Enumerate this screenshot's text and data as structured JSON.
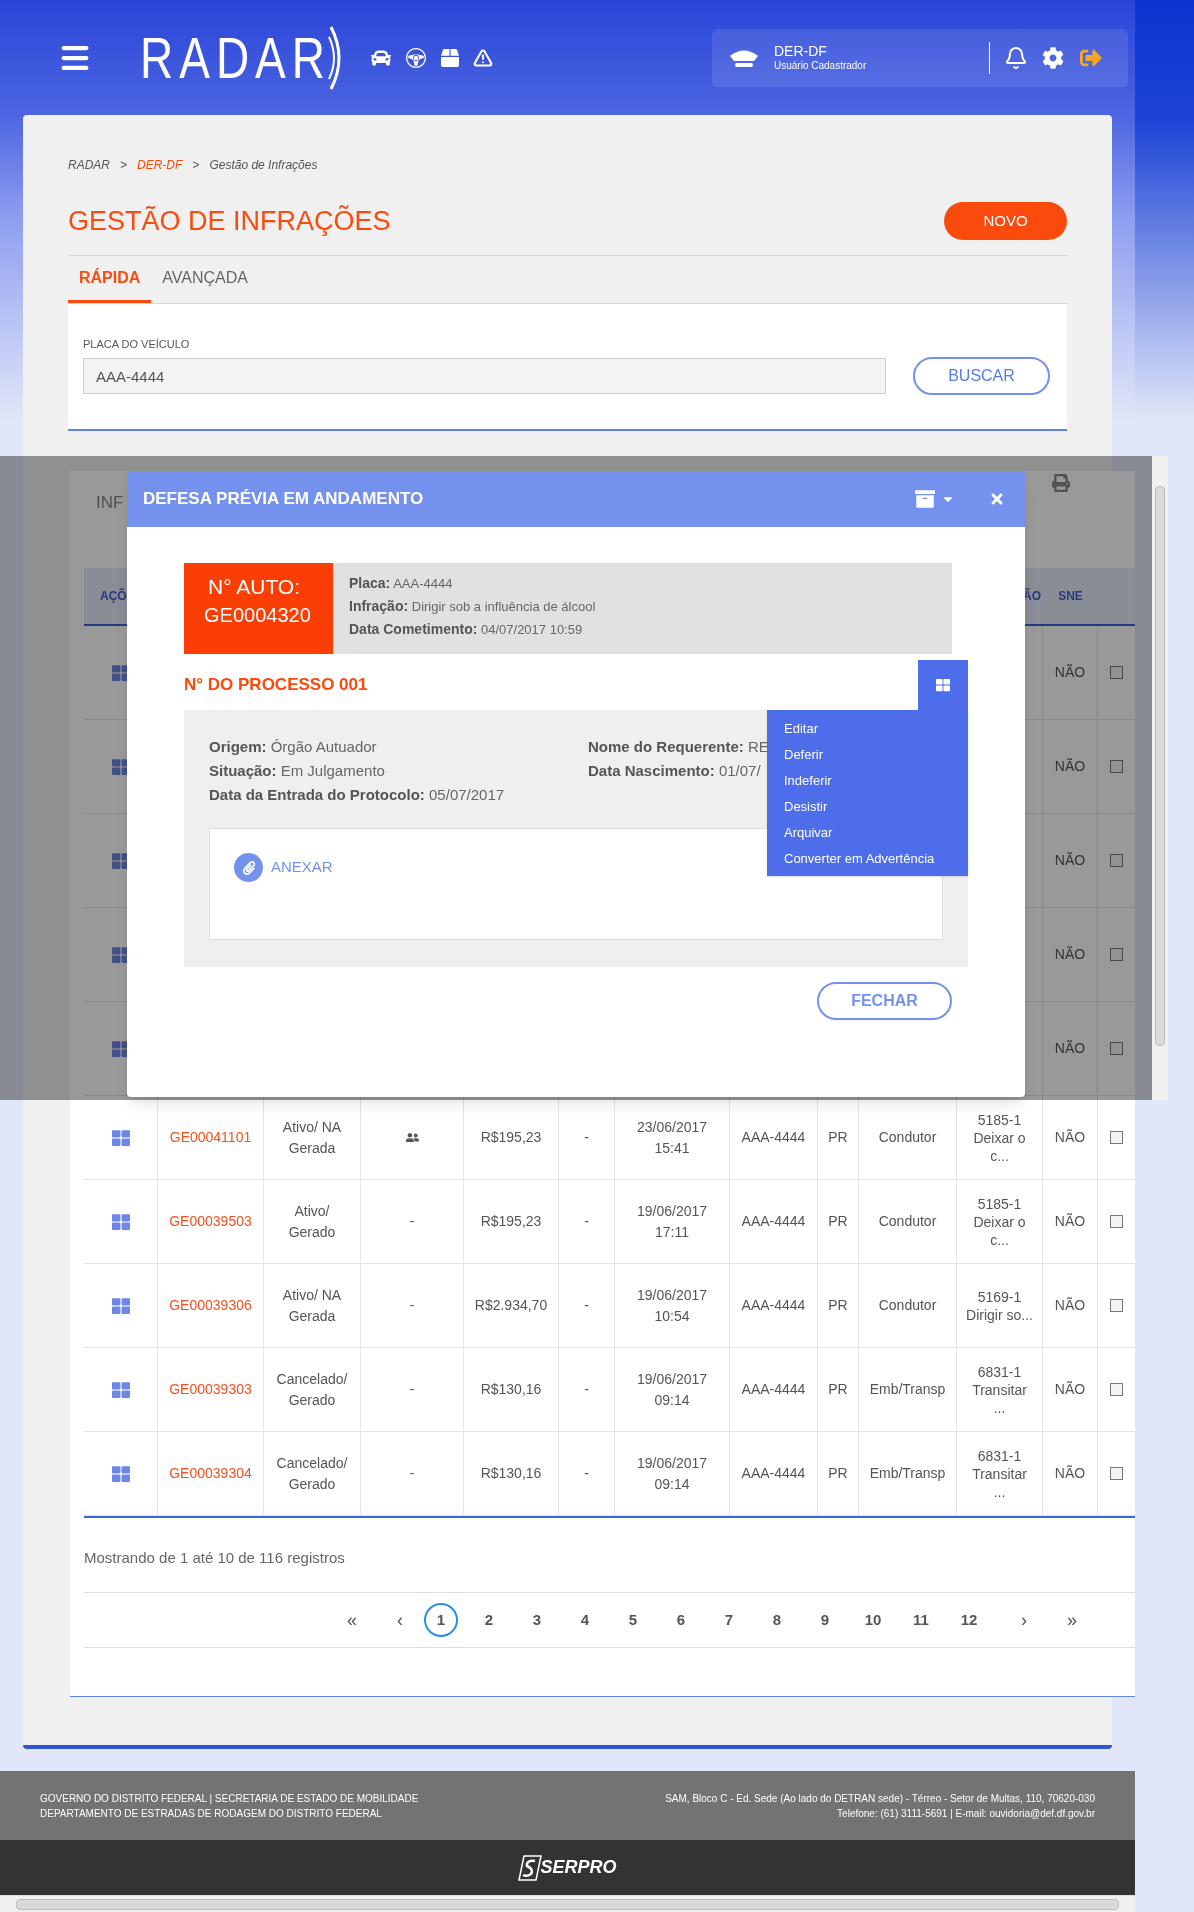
{
  "header": {
    "logo": "RADAR",
    "org": "DER-DF",
    "role": "Usuário Cadastrador"
  },
  "breadcrumb": [
    {
      "label": "RADAR",
      "link": false
    },
    {
      "sep": ">",
      "label": "DER-DF",
      "link": true
    },
    {
      "sep": ">",
      "label": "Gestão de Infrações",
      "link": false
    }
  ],
  "page_title": "GESTÃO DE INFRAÇÕES",
  "new_button": "NOVO",
  "tabs": [
    {
      "label": "RÁPIDA",
      "selected": true
    },
    {
      "label": "AVANÇADA",
      "selected": false
    }
  ],
  "search": {
    "label": "PLACA DO VEÍCULO",
    "value": "AAA-4444",
    "button": "BUSCAR"
  },
  "results": {
    "title": "INF",
    "columns": {
      "actions": "AÇÕ",
      "infraction": "ÃO",
      "sne": "SNE"
    },
    "rows": [
      {
        "sne": "NÃO",
        "checked": false
      },
      {
        "sne": "NÃO",
        "checked": false
      },
      {
        "sne": "NÃO",
        "checked": false
      },
      {
        "sne": "NÃO",
        "checked": false
      },
      {
        "sne": "NÃO",
        "checked": false
      },
      {
        "auto": "GE00041101",
        "status": "Ativo/ NA Gerada",
        "flag": {
          "kind": "icon"
        },
        "value": "R$195,23",
        "c6": "-",
        "date": "23/06/2017 15:41",
        "plate": "AAA-4444",
        "uf": "PR",
        "type": "Condutor",
        "infraction": "5185-1 Deixar o c...",
        "sne": "NÃO",
        "checked": false
      },
      {
        "auto": "GE00039503",
        "status": "Ativo/ Gerado",
        "flag": {
          "kind": "text",
          "text": "-"
        },
        "value": "R$195,23",
        "c6": "-",
        "date": "19/06/2017 17:11",
        "plate": "AAA-4444",
        "uf": "PR",
        "type": "Condutor",
        "infraction": "5185-1 Deixar o c...",
        "sne": "NÃO",
        "checked": false
      },
      {
        "auto": "GE00039306",
        "status": "Ativo/ NA Gerada",
        "flag": {
          "kind": "text",
          "text": "-"
        },
        "value": "R$2.934,70",
        "c6": "-",
        "date": "19/06/2017 10:54",
        "plate": "AAA-4444",
        "uf": "PR",
        "type": "Condutor",
        "infraction": "5169-1 Dirigir so...",
        "sne": "NÃO",
        "checked": false
      },
      {
        "auto": "GE00039303",
        "status": "Cancelado/ Gerado",
        "flag": {
          "kind": "text",
          "text": "-"
        },
        "value": "R$130,16",
        "c6": "-",
        "date": "19/06/2017 09:14",
        "plate": "AAA-4444",
        "uf": "PR",
        "type": "Emb/Transp",
        "infraction": "6831-1 Transitar ...",
        "sne": "NÃO",
        "checked": false
      },
      {
        "auto": "GE00039304",
        "status": "Cancelado/ Gerado",
        "flag": {
          "kind": "text",
          "text": "-"
        },
        "value": "R$130,16",
        "c6": "-",
        "date": "19/06/2017 09:14",
        "plate": "AAA-4444",
        "uf": "PR",
        "type": "Emb/Transp",
        "infraction": "6831-1 Transitar ...",
        "sne": "NÃO",
        "checked": false
      }
    ],
    "summary": "Mostrando de 1 até 10 de 116 registros",
    "pagination": {
      "first": "«",
      "prev": "‹",
      "next": "›",
      "last": "»",
      "pages": [
        {
          "label": "1",
          "selected": true
        },
        {
          "label": "2",
          "selected": false
        },
        {
          "label": "3",
          "selected": false
        },
        {
          "label": "4",
          "selected": false
        },
        {
          "label": "5",
          "selected": false
        },
        {
          "label": "6",
          "selected": false
        },
        {
          "label": "7",
          "selected": false
        },
        {
          "label": "8",
          "selected": false
        },
        {
          "label": "9",
          "selected": false
        },
        {
          "label": "10",
          "selected": false
        },
        {
          "label": "11",
          "selected": false
        },
        {
          "label": "12",
          "selected": false
        }
      ]
    }
  },
  "modal": {
    "title": "DEFESA PRÉVIA EM ANDAMENTO",
    "auto_label": "N° AUTO:",
    "auto_number": "GE0004320",
    "facts": [
      {
        "label": "Placa:",
        "value": "AAA-4444"
      },
      {
        "label": "Infração:",
        "value": "Dirigir sob a influência de álcool"
      },
      {
        "label": "Data Cometimento:",
        "value": "04/07/2017 10:59"
      }
    ],
    "process_title": "N° DO PROCESSO 001",
    "details_left": [
      {
        "label": "Origem:",
        "value": "Órgão Autuador"
      },
      {
        "label": "Situação:",
        "value": "Em Julgamento"
      },
      {
        "label": "Data da Entrada do Protocolo:",
        "value": "05/07/2017"
      }
    ],
    "details_right": [
      {
        "label": "Nome do Requerente:",
        "value": "RE"
      },
      {
        "label": "Data Nascimento:",
        "value": "01/07/"
      }
    ],
    "attach": "ANEXAR",
    "menu": [
      "Editar",
      "Deferir",
      "Indeferir",
      "Desistir",
      "Arquivar",
      "Converter em Advertência"
    ],
    "close_button": "FECHAR"
  },
  "footer": {
    "left": [
      "GOVERNO DO DISTRITO FEDERAL | SECRETARIA DE ESTADO DE MOBILIDADE",
      "DEPARTAMENTO DE ESTRADAS DE RODAGEM DO DISTRITO FEDERAL"
    ],
    "right": [
      "SAM, Bloco C - Ed. Sede (Ao lado do DETRAN sede) - Térreo - Setor de Multas, 110, 70620-030",
      "Telefone: (61) 3111-5691 | E-mail: ouvidoria@def.df.gov.br"
    ],
    "brand": "SERPRO"
  }
}
